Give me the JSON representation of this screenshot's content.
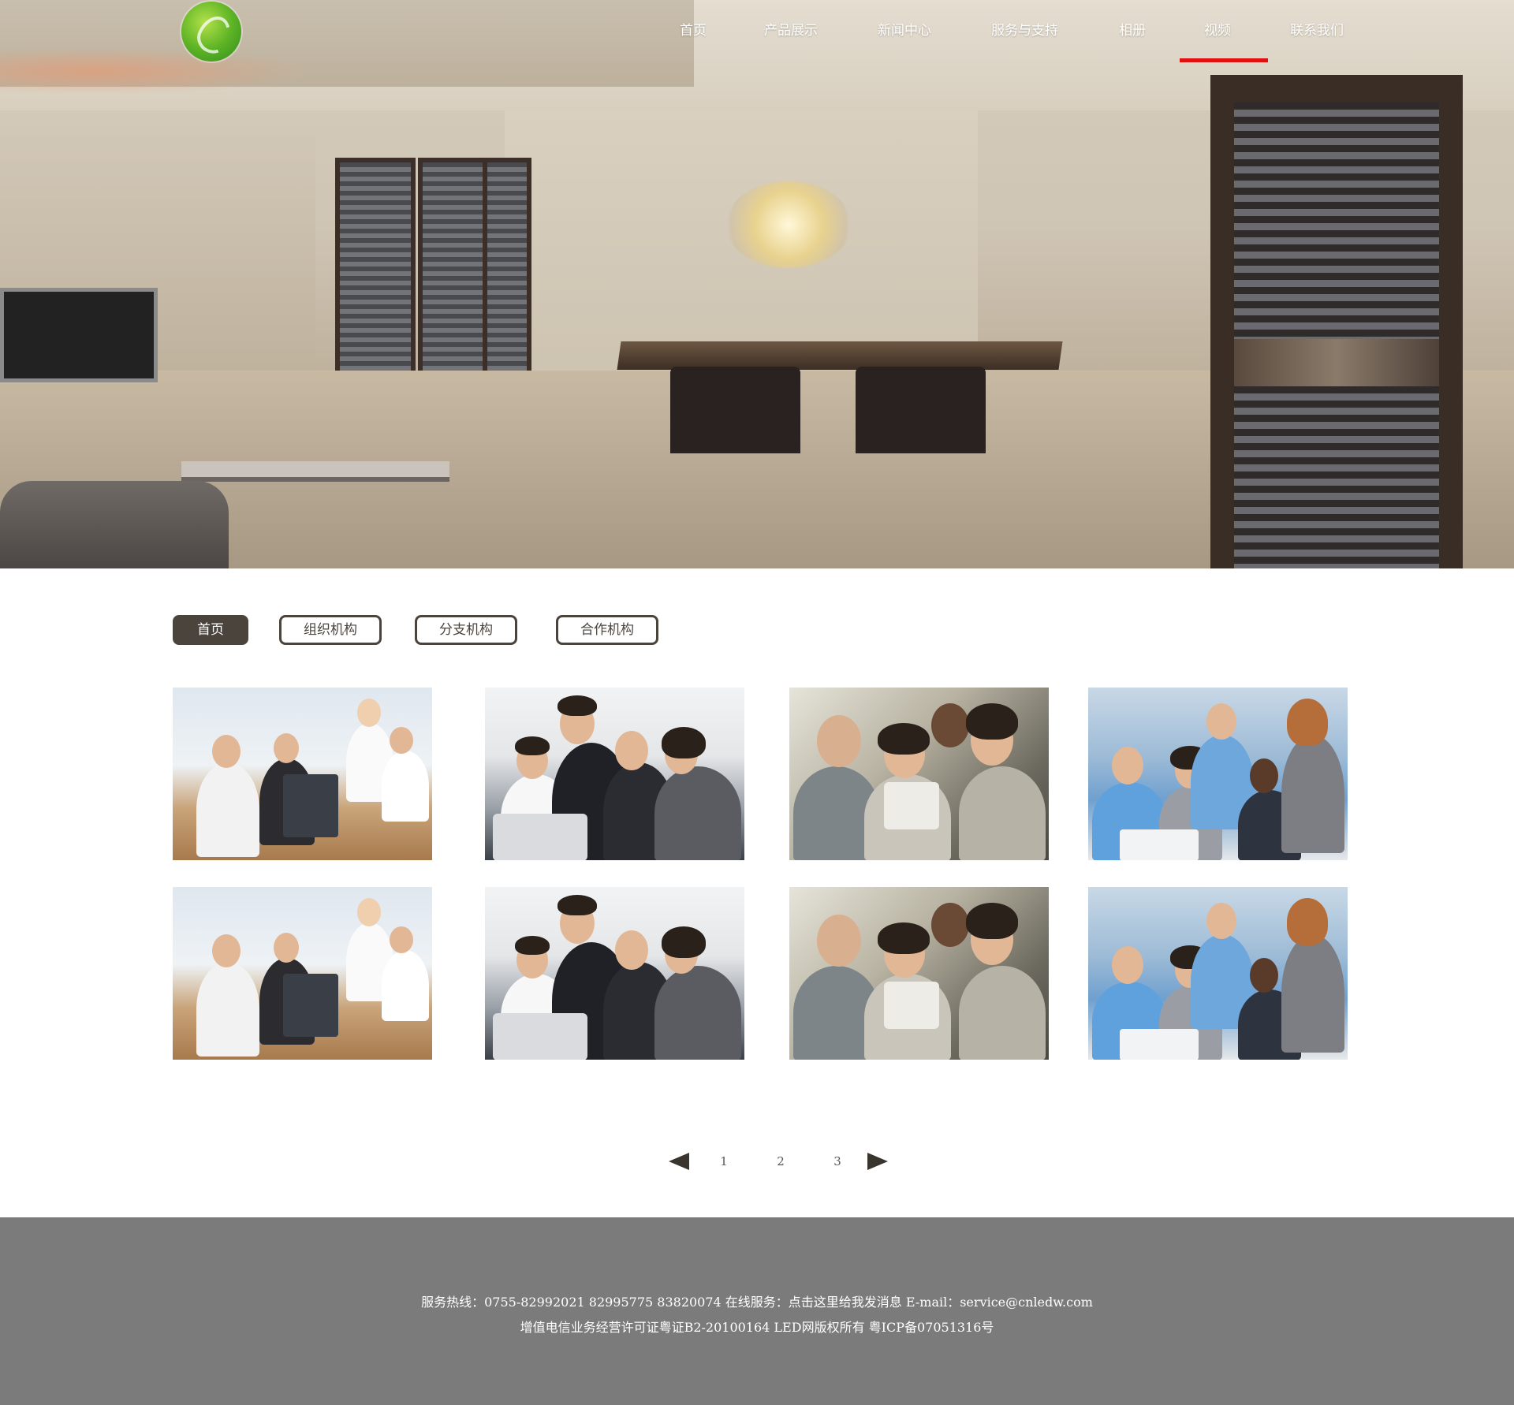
{
  "nav": {
    "items": [
      "首页",
      "产品展示",
      "新闻中心",
      "服务与支持",
      "相册",
      "视频",
      "联系我们"
    ],
    "active_index": 5,
    "active_color": "#e01010"
  },
  "logo": {
    "icon": "globe-leaf-logo",
    "color": "#5fb526"
  },
  "tabs": {
    "items": [
      "首页",
      "组织机构",
      "分支机构",
      "合作机构"
    ],
    "active_index": 0,
    "active_color": "#4a443d"
  },
  "gallery": {
    "rows": 2,
    "columns": 4,
    "photos": [
      "meeting-room-photo",
      "team-laptop-photo",
      "team-tablet-photo",
      "office-team-photo",
      "meeting-room-photo",
      "team-laptop-photo",
      "team-tablet-photo",
      "office-team-photo"
    ]
  },
  "pagination": {
    "prev_icon": "arrow-left-icon",
    "next_icon": "arrow-right-icon",
    "pages": [
      "1",
      "2",
      "3"
    ]
  },
  "footer": {
    "line1": "服务热线：0755-82992021 82995775 83820074 在线服务：点击这里给我发消息 E-mail：service@cnledw.com",
    "line2": "增值电信业务经营许可证粤证B2-20100164 LED网版权所有 粤ICP备07051316号",
    "background": "#7b7b7b"
  }
}
